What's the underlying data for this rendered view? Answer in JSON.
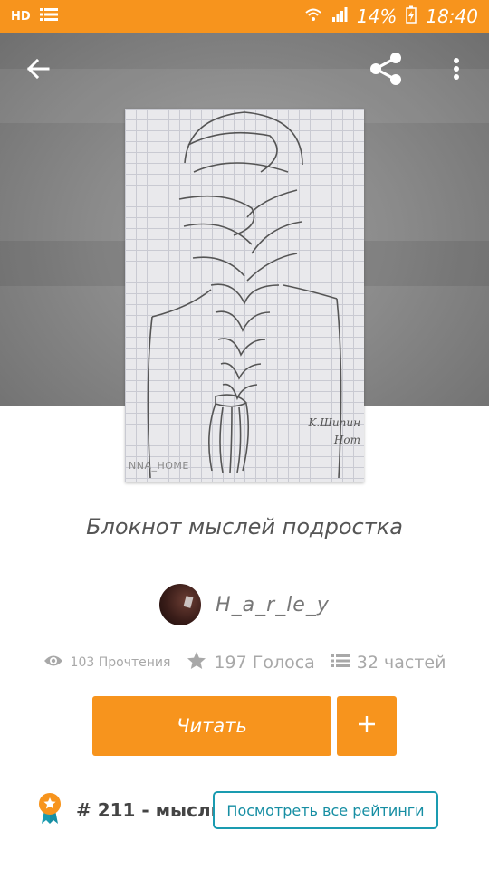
{
  "status_bar": {
    "network_label": "HD",
    "battery": "14%",
    "time": "18:40"
  },
  "hero": {
    "icons": {
      "back": "arrow-left-icon",
      "share": "share-icon",
      "more": "more-vert-icon"
    }
  },
  "cover": {
    "signature_line1": "K.Шипин",
    "signature_line2": "Hom",
    "watermark": "NNA_HOME"
  },
  "story": {
    "title": "Блокнот мыслей подростка",
    "author": "H_a_r_le_y"
  },
  "stats": {
    "reads": "103 Прочтения",
    "votes": "197 Голоса",
    "parts": "32 частей"
  },
  "actions": {
    "read_label": "Читать",
    "add_label": "+"
  },
  "ranking": {
    "rank_text": "# 211 - мысли",
    "view_all_label": "Посмотреть все рейтинги"
  },
  "colors": {
    "accent": "#f7941d",
    "link": "#168ea3",
    "muted": "#a8a8a8"
  }
}
